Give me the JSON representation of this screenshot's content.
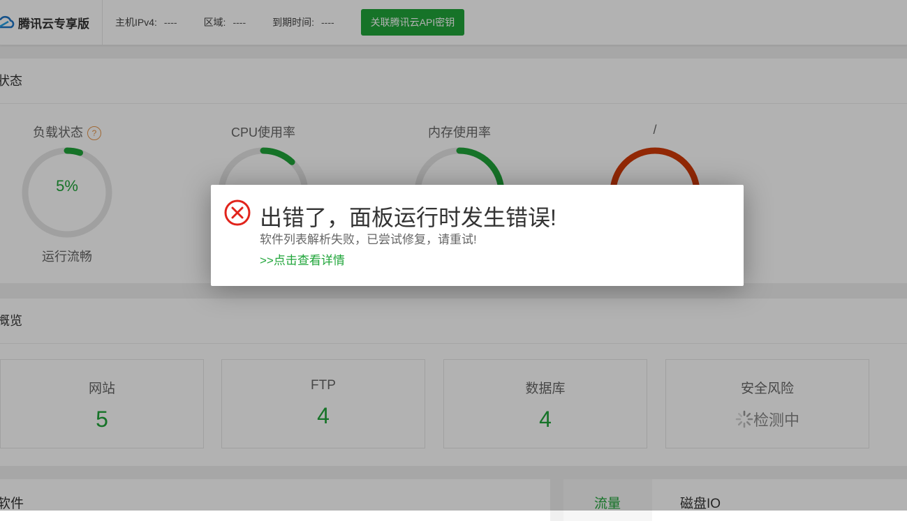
{
  "header": {
    "brand": "腾讯云专享版",
    "ipv4_label": "主机IPv4:",
    "ipv4_value": "----",
    "region_label": "区域:",
    "region_value": "----",
    "expire_label": "到期时间:",
    "expire_value": "----",
    "bind_button": "关联腾讯云API密钥"
  },
  "status": {
    "title": "状态",
    "gauges": [
      {
        "label": "负载状态",
        "value": "5%",
        "sub": "运行流畅",
        "level": 0.05,
        "color": "#20a53a"
      },
      {
        "label": "CPU使用率",
        "value": "",
        "sub": "",
        "level": 0.12,
        "color": "#20a53a"
      },
      {
        "label": "内存使用率",
        "value": "",
        "sub": "",
        "level": 0.38,
        "color": "#20a53a"
      },
      {
        "label": "/",
        "value": "",
        "sub": "",
        "level": 1.0,
        "color": "#d23a08"
      }
    ]
  },
  "overview": {
    "title": "概览",
    "cards": [
      {
        "title": "网站",
        "count": "5"
      },
      {
        "title": "FTP",
        "count": "4"
      },
      {
        "title": "数据库",
        "count": "4"
      },
      {
        "title": "安全风险",
        "status": "检测中"
      }
    ]
  },
  "software": {
    "title": "软件"
  },
  "io": {
    "tab_traffic": "流量",
    "tab_disk": "磁盘IO"
  },
  "dialog": {
    "title": "出错了，面板运行时发生错误!",
    "message": "软件列表解析失败，已尝试修复，请重试!",
    "link": ">>点击查看详情"
  },
  "colors": {
    "accent": "#20a53a",
    "danger": "#e1231b",
    "disk_full": "#d23a08"
  }
}
